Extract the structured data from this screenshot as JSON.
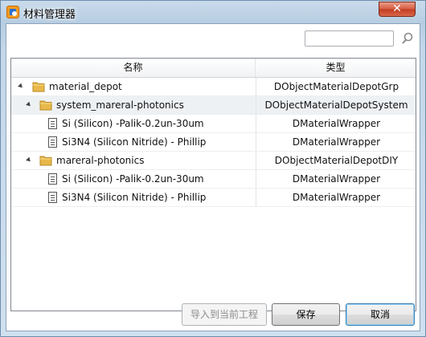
{
  "window": {
    "title": "材料管理器",
    "close_label": "✕"
  },
  "search": {
    "value": "",
    "placeholder": ""
  },
  "tree": {
    "columns": [
      "名称",
      "类型"
    ],
    "rows": [
      {
        "name": "material_depot",
        "type": "DObjectMaterialDepotGrp",
        "icon": "folder-icon",
        "expanded": true
      },
      {
        "name": "system_mareral-photonics",
        "type": "DObjectMaterialDepotSystem",
        "icon": "folder-icon",
        "expanded": true
      },
      {
        "name": "Si (Silicon) -Palik-0.2un-30um",
        "type": "DMaterialWrapper",
        "icon": "document-icon"
      },
      {
        "name": "Si3N4 (Silicon Nitride) - Phillip",
        "type": "DMaterialWrapper",
        "icon": "document-icon"
      },
      {
        "name": "mareral-photonics",
        "type": "DObjectMaterialDepotDIY",
        "icon": "folder-icon",
        "expanded": true
      },
      {
        "name": "Si (Silicon) -Palik-0.2un-30um",
        "type": "DMaterialWrapper",
        "icon": "document-icon"
      },
      {
        "name": "Si3N4 (Silicon Nitride) - Phillip",
        "type": "DMaterialWrapper",
        "icon": "document-icon"
      }
    ]
  },
  "buttons": {
    "import_label": "导入到当前工程",
    "save_label": "保存",
    "cancel_label": "取消"
  },
  "colors": {
    "title_gradient": "#c9dbeb",
    "close_red": "#c23b20",
    "folder_yellow": "#e8b84a",
    "selected_row": "#eef1f4"
  }
}
